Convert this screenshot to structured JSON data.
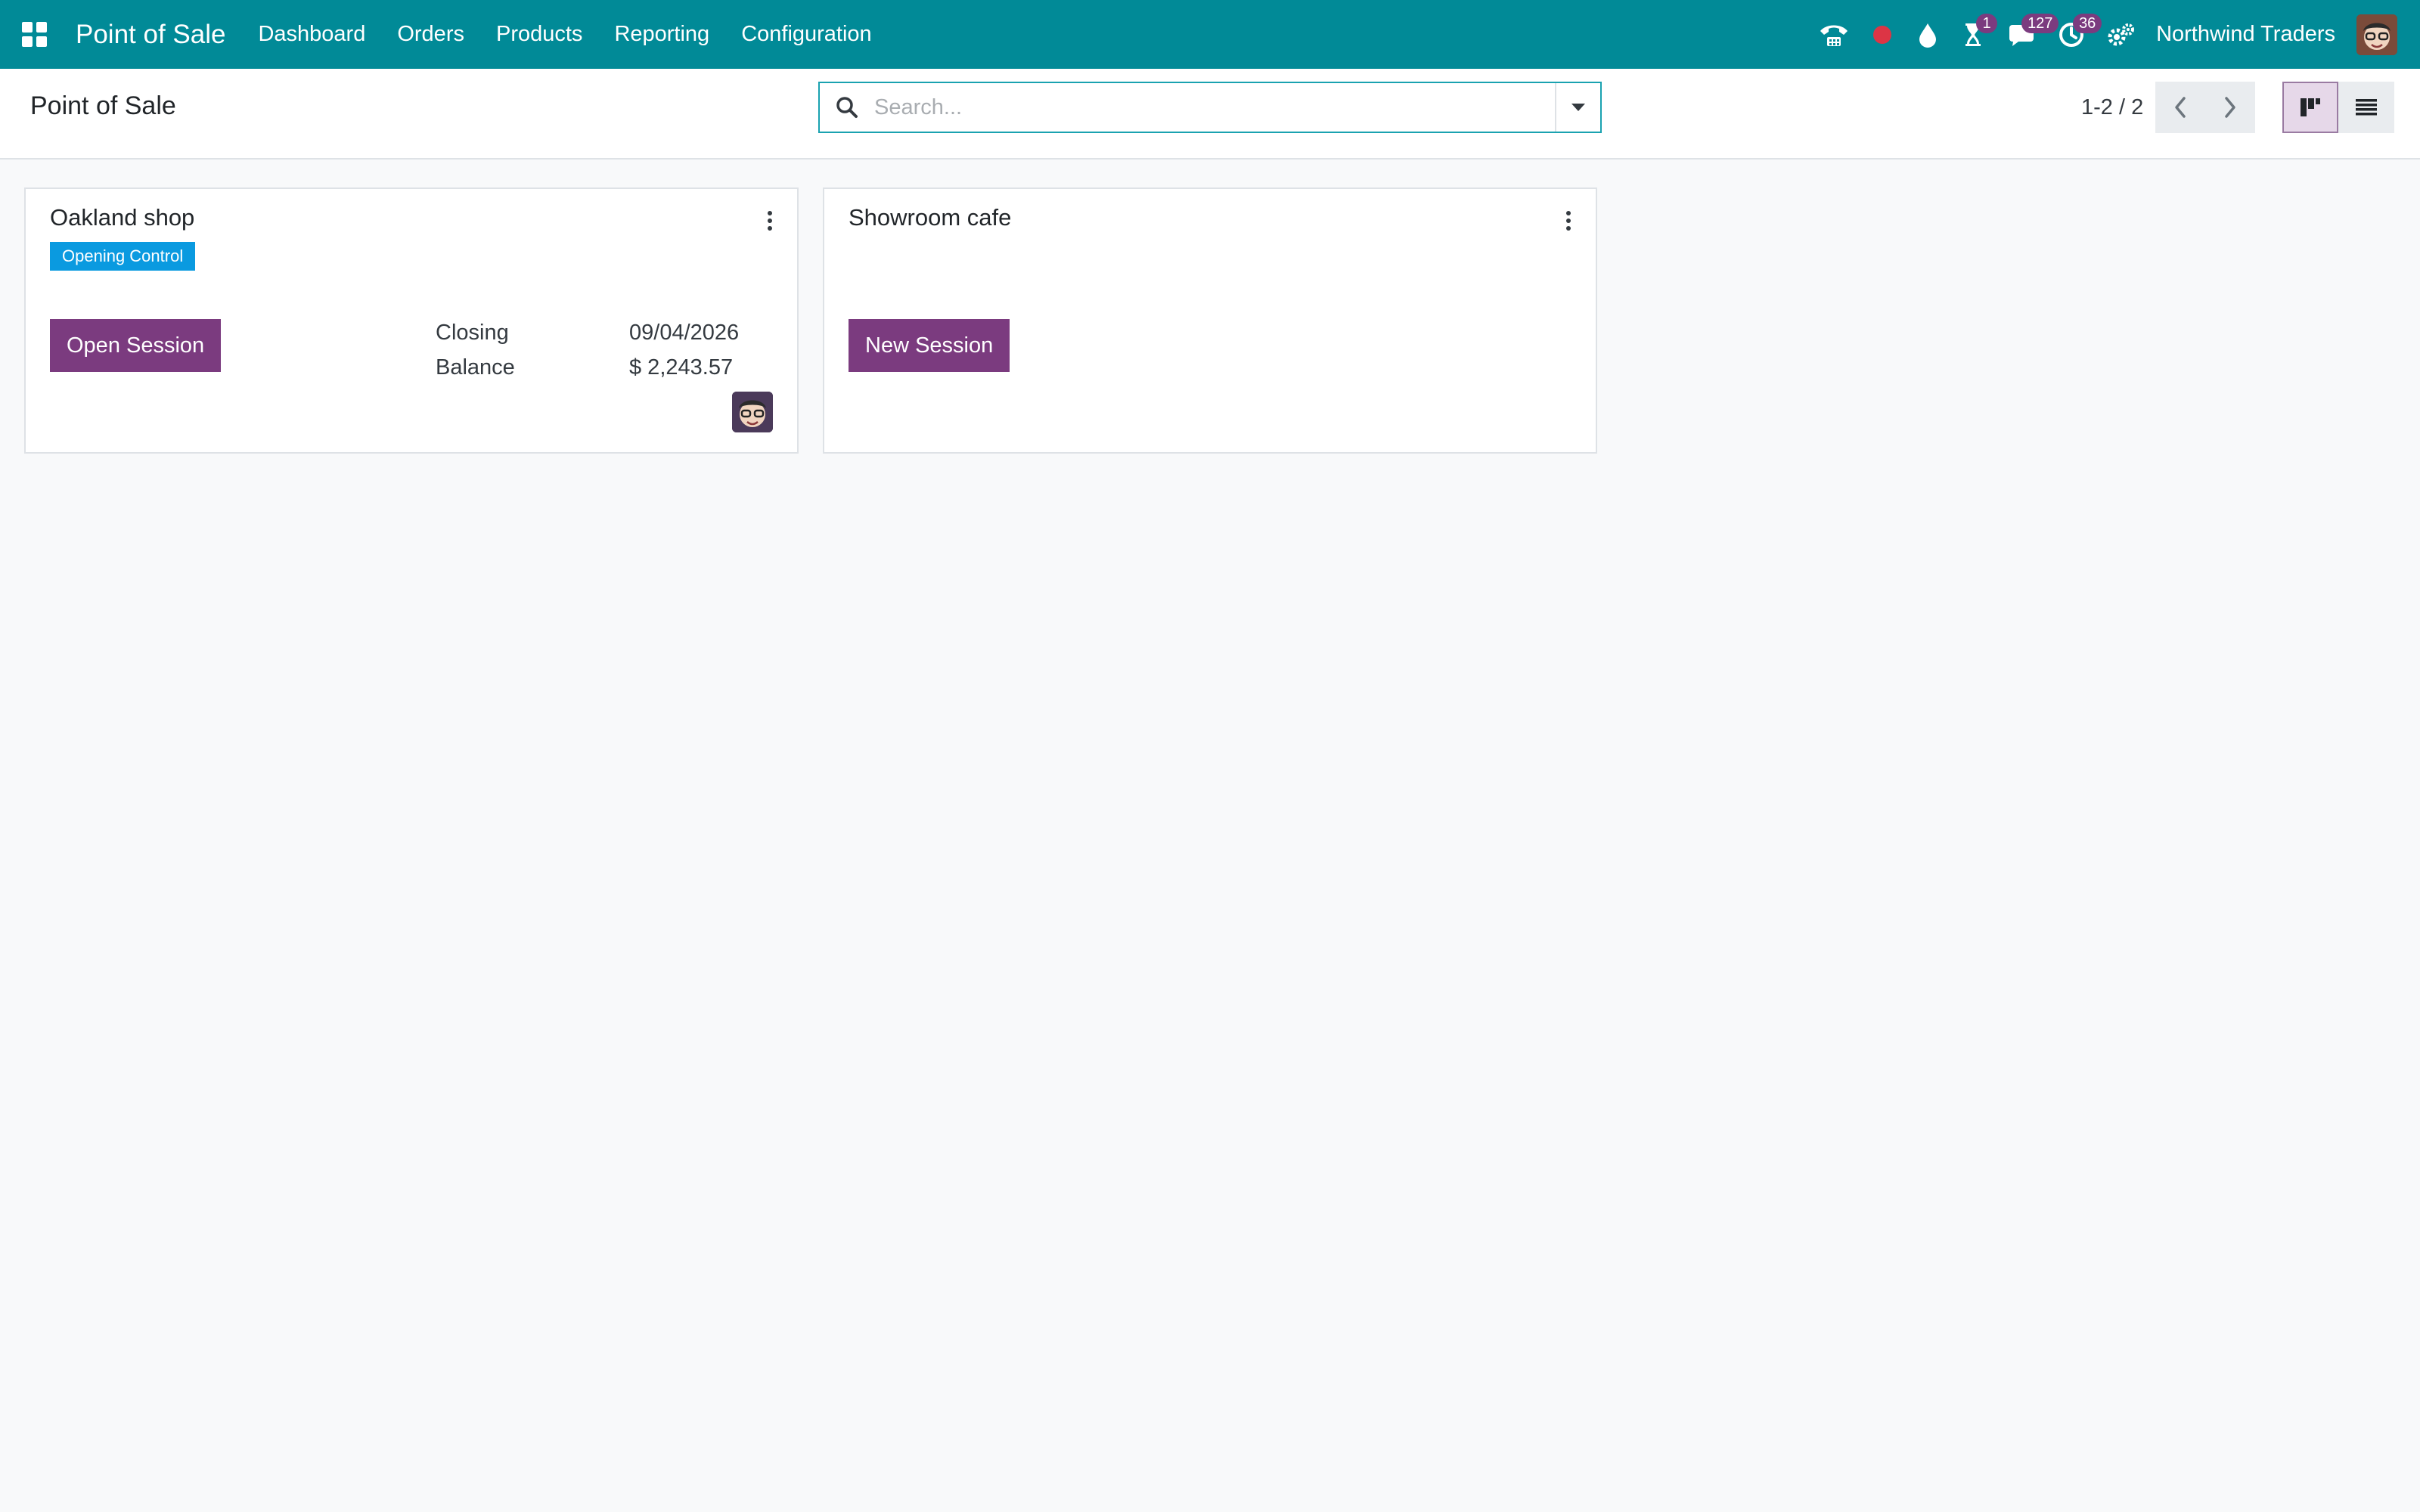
{
  "navbar": {
    "app_name": "Point of Sale",
    "menu": [
      "Dashboard",
      "Orders",
      "Products",
      "Reporting",
      "Configuration"
    ],
    "systray": {
      "activity_badge": "1",
      "messages_badge": "127",
      "activities_badge": "36"
    },
    "company": "Northwind Traders",
    "bar_color": "#018a97",
    "badge_color": "#7b3b7f"
  },
  "control_panel": {
    "title": "Point of Sale",
    "search_placeholder": "Search...",
    "pager": "1-2 / 2"
  },
  "kanban": {
    "cards": [
      {
        "name": "Oakland shop",
        "status": "Opening Control",
        "button": "Open Session",
        "closing_label": "Closing",
        "closing_value": "09/04/2026",
        "balance_label": "Balance",
        "balance_value": "$ 2,243.57"
      },
      {
        "name": "Showroom cafe",
        "button": "New Session"
      }
    ]
  },
  "colors": {
    "primary": "#7b3b7f",
    "status_tag": "#0a9ae0"
  }
}
